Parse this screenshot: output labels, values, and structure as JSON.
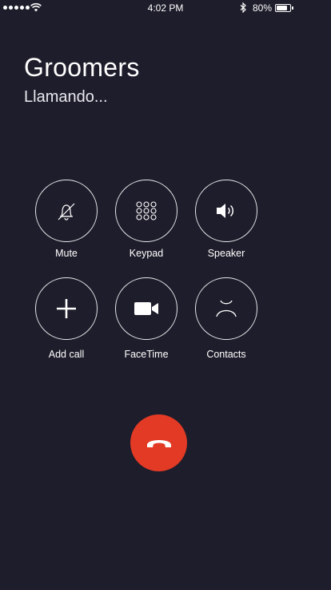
{
  "status_bar": {
    "time": "4:02 PM",
    "battery_percent": "80%",
    "battery_level": 0.8,
    "icons": [
      "signal-dots-icon",
      "wifi-icon",
      "bluetooth-icon",
      "battery-icon"
    ]
  },
  "call": {
    "contact_name": "Groomers",
    "status": "Llamando..."
  },
  "controls": [
    {
      "label": "Mute",
      "icon": "mute-bell-icon"
    },
    {
      "label": "Keypad",
      "icon": "keypad-icon"
    },
    {
      "label": "Speaker",
      "icon": "speaker-icon"
    },
    {
      "label": "Add call",
      "icon": "plus-icon"
    },
    {
      "label": "FaceTime",
      "icon": "video-camera-icon"
    },
    {
      "label": "Contacts",
      "icon": "contacts-icon"
    }
  ],
  "end_call": {
    "icon": "phone-hangup-icon",
    "color": "#e23a25"
  },
  "colors": {
    "background": "#1e1d2b",
    "end_call": "#e23a25",
    "text": "#ffffff"
  }
}
